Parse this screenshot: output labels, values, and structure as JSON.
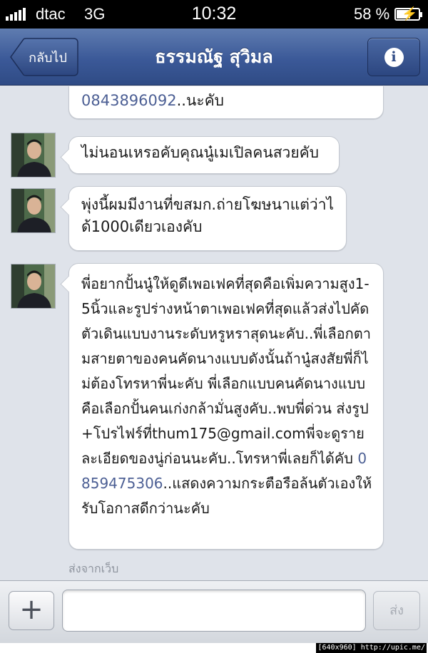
{
  "status_bar": {
    "carrier": "dtac",
    "network": "3G",
    "time": "10:32",
    "battery_percent": "58 %",
    "battery_level": 0.58,
    "signal_icon": "signal-bars-icon",
    "battery_icon": "battery-charging-icon"
  },
  "nav": {
    "back_label": "กลับไป",
    "title": "ธรรมณัฐ สุวิมล",
    "info_icon": "info-icon",
    "info_glyph": "i"
  },
  "messages": [
    {
      "link": "0843896092",
      "text": "..นะคับ"
    },
    {
      "text": "ไม่นอนเหรอคับคุณนู๋เมเปิลคนสวยคับ"
    },
    {
      "text": "พุ่งนี้ผมมีงานที่ขสมก.ถ่ายโฆษนาแต่ว่าได้1000เดียวเองคับ"
    },
    {
      "text_before": "พี่อยากปั้นนู๋ให้ดูดีเพอเฟคที่สุดคือเพิ่มความสูง1-5นิ้วและรูปร่างหน้าตาเพอเฟคที่สุดแล้วส่งไปคัดตัวเดินแบบงานระดับหรูหราสุดนะคับ..พี่เลือกตามสายตาของคนคัดนางแบบดังนั้นถ้านู๋สงสัยพี่ก็ไม่ต้องโทรหาพี่นะคับ พี่เลือกแบบคนคัดนางแบบคือเลือกปั้นคนเก่งกล้ามั่นสูงคับ..พบพี่ด่วน ส่งรูป+โปรไฟร์ที่thum175@gmail.comพี่จะดูรายละเอียดของนู่ก่อนนะคับ..โทรหาพี่เลยก็ได้คับ ",
      "link": "0859475306",
      "text_after": "..แสดงความกระตือรือล้นตัวเองให้รับโอกาสดีกว่านะคับ"
    }
  ],
  "source_label": "ส่งจากเว็บ",
  "composer": {
    "plus_label": "+",
    "input_placeholder": "",
    "send_label": "ส่ง"
  },
  "watermark": "[640x960] http://upic.me/",
  "colors": {
    "navbar": "#3b5998",
    "background": "#dfe3ea",
    "link": "#4c5f94"
  }
}
